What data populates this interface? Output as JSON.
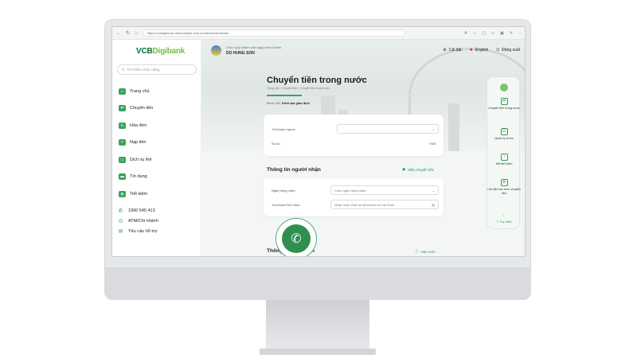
{
  "browser": {
    "url": "https://vcbdigibank.vietcombank.com.vn/transfer/domestic"
  },
  "sidebar": {
    "logo_main": "VCB",
    "logo_accent": "Digibank",
    "search_placeholder": "Tìm kiếm chức năng",
    "items": [
      {
        "label": "Trang chủ",
        "icon": "home-icon"
      },
      {
        "label": "Chuyển tiền",
        "icon": "transfer-icon"
      },
      {
        "label": "Hóa đơn",
        "icon": "bill-icon"
      },
      {
        "label": "Nạp tiền",
        "icon": "topup-icon"
      },
      {
        "label": "Dịch vụ thẻ",
        "icon": "card-icon"
      },
      {
        "label": "Tín dụng",
        "icon": "credit-icon"
      },
      {
        "label": "Tiết kiệm",
        "icon": "savings-icon"
      }
    ],
    "footer": [
      {
        "label": "1900 545 413",
        "icon": "phone-icon"
      },
      {
        "label": "ATM/Chi nhánh",
        "icon": "location-icon"
      },
      {
        "label": "Yêu cầu hỗ trợ",
        "icon": "support-icon"
      }
    ]
  },
  "header": {
    "greeting": "Chúc Quý khách một ngày mới tốt lành",
    "user_name": "DO HUNG SON",
    "settings_label": "Cài đặt",
    "language_label": "English",
    "logout_label": "Đăng xuất"
  },
  "main": {
    "page_title": "Chuyển tiền trong nước",
    "breadcrumb": "Trang chủ  >  Chuyển tiền  >  Chuyển tiền trong nước",
    "progress": 0.2,
    "step_prefix": "Bước 1/6",
    "step_name": "Khởi tạo giao dịch",
    "source_account_label": "Tài khoản nguồn",
    "balance_label": "Số dư",
    "balance_currency": "VND",
    "recipient_section_title": "Thông tin người nhận",
    "template_link": "Mẫu chuyển tiền",
    "bank_label": "Ngân hàng nhận",
    "bank_placeholder": "Chọn ngân hàng nhận",
    "account_label": "Tài khoản/Thẻ nhận",
    "account_placeholder": "Nhập hoặc chọn số tài khoản/ số thẻ nhận",
    "transaction_section_title": "Thông tin giao dịch",
    "limit_link": "Hạn mức"
  },
  "quick_panel": {
    "items": [
      {
        "label": "Chuyển tiền trong nước",
        "icon": "transfer-icon"
      },
      {
        "label": "Quản lý nhóm",
        "icon": "group-icon"
      },
      {
        "label": "Mở tiết kiệm",
        "icon": "piggy-icon"
      },
      {
        "label": "Cài đặt hạn mức chuyển tiền",
        "icon": "limit-icon"
      }
    ],
    "footer": "Tùy chỉnh"
  },
  "colors": {
    "brand_green": "#0a6b34",
    "accent_green": "#6fbe44",
    "action_green": "#2f8f4f"
  }
}
